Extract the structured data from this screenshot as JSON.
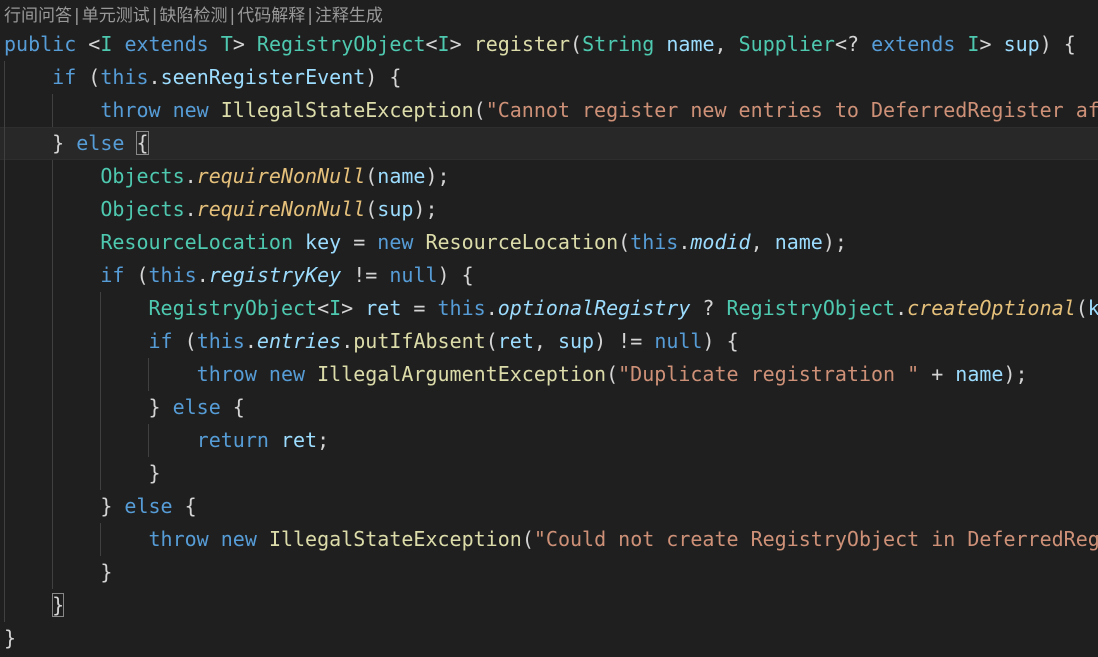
{
  "codelens": {
    "items": [
      "行间问答",
      "单元测试",
      "缺陷检测",
      "代码解释",
      "注释生成"
    ],
    "separator": "|"
  },
  "colors": {
    "background": "#1f1f1f",
    "keyword": "#569cd6",
    "type": "#4ec9b0",
    "function": "#dcdcaa",
    "string": "#ce9178",
    "variable": "#9cdcfe",
    "static_method": "#e5c07b",
    "codelens": "#999999"
  },
  "code": {
    "lines": [
      [
        [
          "k",
          "public"
        ],
        [
          "sy",
          " <"
        ],
        [
          "t",
          "I"
        ],
        [
          "sy",
          " "
        ],
        [
          "k",
          "extends"
        ],
        [
          "sy",
          " "
        ],
        [
          "t",
          "T"
        ],
        [
          "sy",
          "> "
        ],
        [
          "t",
          "RegistryObject"
        ],
        [
          "sy",
          "<"
        ],
        [
          "t",
          "I"
        ],
        [
          "sy",
          "> "
        ],
        [
          "f",
          "register"
        ],
        [
          "sy",
          "("
        ],
        [
          "t",
          "String"
        ],
        [
          "sy",
          " "
        ],
        [
          "p",
          "name"
        ],
        [
          "sy",
          ", "
        ],
        [
          "t",
          "Supplier"
        ],
        [
          "sy",
          "<? "
        ],
        [
          "k",
          "extends"
        ],
        [
          "sy",
          " "
        ],
        [
          "t",
          "I"
        ],
        [
          "sy",
          "> "
        ],
        [
          "p",
          "sup"
        ],
        [
          "sy",
          ") {"
        ]
      ],
      [
        [
          "sy",
          "    "
        ],
        [
          "k",
          "if"
        ],
        [
          "sy",
          " ("
        ],
        [
          "k",
          "this"
        ],
        [
          "sy",
          "."
        ],
        [
          "p",
          "seenRegisterEvent"
        ],
        [
          "sy",
          ") {"
        ]
      ],
      [
        [
          "sy",
          "        "
        ],
        [
          "k",
          "throw"
        ],
        [
          "sy",
          " "
        ],
        [
          "k",
          "new"
        ],
        [
          "sy",
          " "
        ],
        [
          "f",
          "IllegalStateException"
        ],
        [
          "sy",
          "("
        ],
        [
          "s",
          "\"Cannot register new entries to DeferredRegister aft"
        ]
      ],
      [
        [
          "sy",
          "    } "
        ],
        [
          "k",
          "else"
        ],
        [
          "sy",
          " "
        ],
        [
          "bm",
          "{"
        ]
      ],
      [
        [
          "sy",
          "        "
        ],
        [
          "t",
          "Objects"
        ],
        [
          "sy",
          "."
        ],
        [
          "sm",
          "requireNonNull"
        ],
        [
          "sy",
          "("
        ],
        [
          "p",
          "name"
        ],
        [
          "sy",
          ");"
        ]
      ],
      [
        [
          "sy",
          "        "
        ],
        [
          "t",
          "Objects"
        ],
        [
          "sy",
          "."
        ],
        [
          "sm",
          "requireNonNull"
        ],
        [
          "sy",
          "("
        ],
        [
          "p",
          "sup"
        ],
        [
          "sy",
          ");"
        ]
      ],
      [
        [
          "sy",
          "        "
        ],
        [
          "t",
          "ResourceLocation"
        ],
        [
          "sy",
          " "
        ],
        [
          "p",
          "key"
        ],
        [
          "sy",
          " = "
        ],
        [
          "k",
          "new"
        ],
        [
          "sy",
          " "
        ],
        [
          "f",
          "ResourceLocation"
        ],
        [
          "sy",
          "("
        ],
        [
          "k",
          "this"
        ],
        [
          "sy",
          "."
        ],
        [
          "fi",
          "modid"
        ],
        [
          "sy",
          ", "
        ],
        [
          "p",
          "name"
        ],
        [
          "sy",
          ");"
        ]
      ],
      [
        [
          "sy",
          "        "
        ],
        [
          "k",
          "if"
        ],
        [
          "sy",
          " ("
        ],
        [
          "k",
          "this"
        ],
        [
          "sy",
          "."
        ],
        [
          "fi",
          "registryKey"
        ],
        [
          "sy",
          " != "
        ],
        [
          "k",
          "null"
        ],
        [
          "sy",
          ") {"
        ]
      ],
      [
        [
          "sy",
          "            "
        ],
        [
          "t",
          "RegistryObject"
        ],
        [
          "sy",
          "<"
        ],
        [
          "t",
          "I"
        ],
        [
          "sy",
          "> "
        ],
        [
          "p",
          "ret"
        ],
        [
          "sy",
          " = "
        ],
        [
          "k",
          "this"
        ],
        [
          "sy",
          "."
        ],
        [
          "fi",
          "optionalRegistry"
        ],
        [
          "sy",
          " ? "
        ],
        [
          "t",
          "RegistryObject"
        ],
        [
          "sy",
          "."
        ],
        [
          "sm",
          "createOptional"
        ],
        [
          "sy",
          "("
        ],
        [
          "p",
          "k"
        ]
      ],
      [
        [
          "sy",
          "            "
        ],
        [
          "k",
          "if"
        ],
        [
          "sy",
          " ("
        ],
        [
          "k",
          "this"
        ],
        [
          "sy",
          "."
        ],
        [
          "fi",
          "entries"
        ],
        [
          "sy",
          "."
        ],
        [
          "f",
          "putIfAbsent"
        ],
        [
          "sy",
          "("
        ],
        [
          "p",
          "ret"
        ],
        [
          "sy",
          ", "
        ],
        [
          "p",
          "sup"
        ],
        [
          "sy",
          ") != "
        ],
        [
          "k",
          "null"
        ],
        [
          "sy",
          ") {"
        ]
      ],
      [
        [
          "sy",
          "                "
        ],
        [
          "k",
          "throw"
        ],
        [
          "sy",
          " "
        ],
        [
          "k",
          "new"
        ],
        [
          "sy",
          " "
        ],
        [
          "f",
          "IllegalArgumentException"
        ],
        [
          "sy",
          "("
        ],
        [
          "s",
          "\"Duplicate registration \""
        ],
        [
          "sy",
          " + "
        ],
        [
          "p",
          "name"
        ],
        [
          "sy",
          ");"
        ]
      ],
      [
        [
          "sy",
          "            } "
        ],
        [
          "k",
          "else"
        ],
        [
          "sy",
          " {"
        ]
      ],
      [
        [
          "sy",
          "                "
        ],
        [
          "k",
          "return"
        ],
        [
          "sy",
          " "
        ],
        [
          "p",
          "ret"
        ],
        [
          "sy",
          ";"
        ]
      ],
      [
        [
          "sy",
          "            }"
        ]
      ],
      [
        [
          "sy",
          "        } "
        ],
        [
          "k",
          "else"
        ],
        [
          "sy",
          " {"
        ]
      ],
      [
        [
          "sy",
          "            "
        ],
        [
          "k",
          "throw"
        ],
        [
          "sy",
          " "
        ],
        [
          "k",
          "new"
        ],
        [
          "sy",
          " "
        ],
        [
          "f",
          "IllegalStateException"
        ],
        [
          "sy",
          "("
        ],
        [
          "s",
          "\"Could not create RegistryObject in DeferredReg"
        ]
      ],
      [
        [
          "sy",
          "        }"
        ]
      ],
      [
        [
          "sy",
          "    "
        ],
        [
          "bm",
          "}"
        ]
      ],
      [
        [
          "sy",
          "}"
        ]
      ]
    ],
    "current_line_index": 3
  }
}
